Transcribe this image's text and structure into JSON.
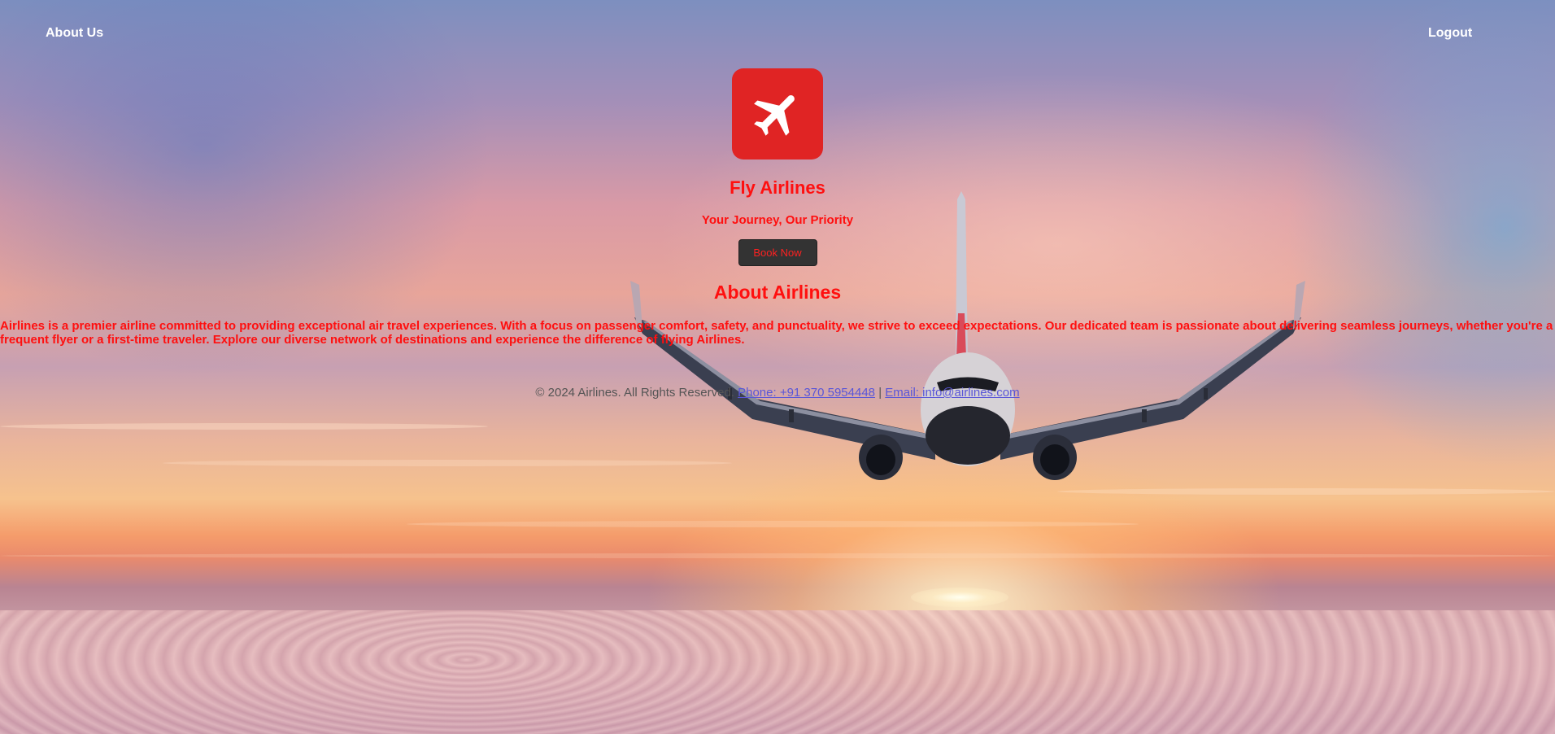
{
  "nav": {
    "about_label": "About Us",
    "logout_label": "Logout"
  },
  "hero": {
    "logo_icon": "airplane-icon",
    "title": "Fly Airlines",
    "tagline": "Your Journey, Our Priority",
    "book_label": "Book Now"
  },
  "about": {
    "heading": "About Airlines",
    "body": "Airlines is a premier airline committed to providing exceptional air travel experiences. With a focus on passenger comfort, safety, and punctuality, we strive to exceed expectations. Our dedicated team is passionate about delivering seamless journeys, whether you're a frequent flyer or a first-time traveler. Explore our diverse network of destinations and experience the difference of flying Airlines."
  },
  "footer": {
    "copyright": "© 2024 Airlines. All Rights Reserved.",
    "phone_link": "Phone: +91 370 5954448",
    "separator": "|",
    "email_link": "Email: info@airlines.com"
  },
  "colors": {
    "accent": "#ff0f0f",
    "logo_bg": "#e02424",
    "button_bg": "#333333",
    "link": "#5a56d8"
  }
}
